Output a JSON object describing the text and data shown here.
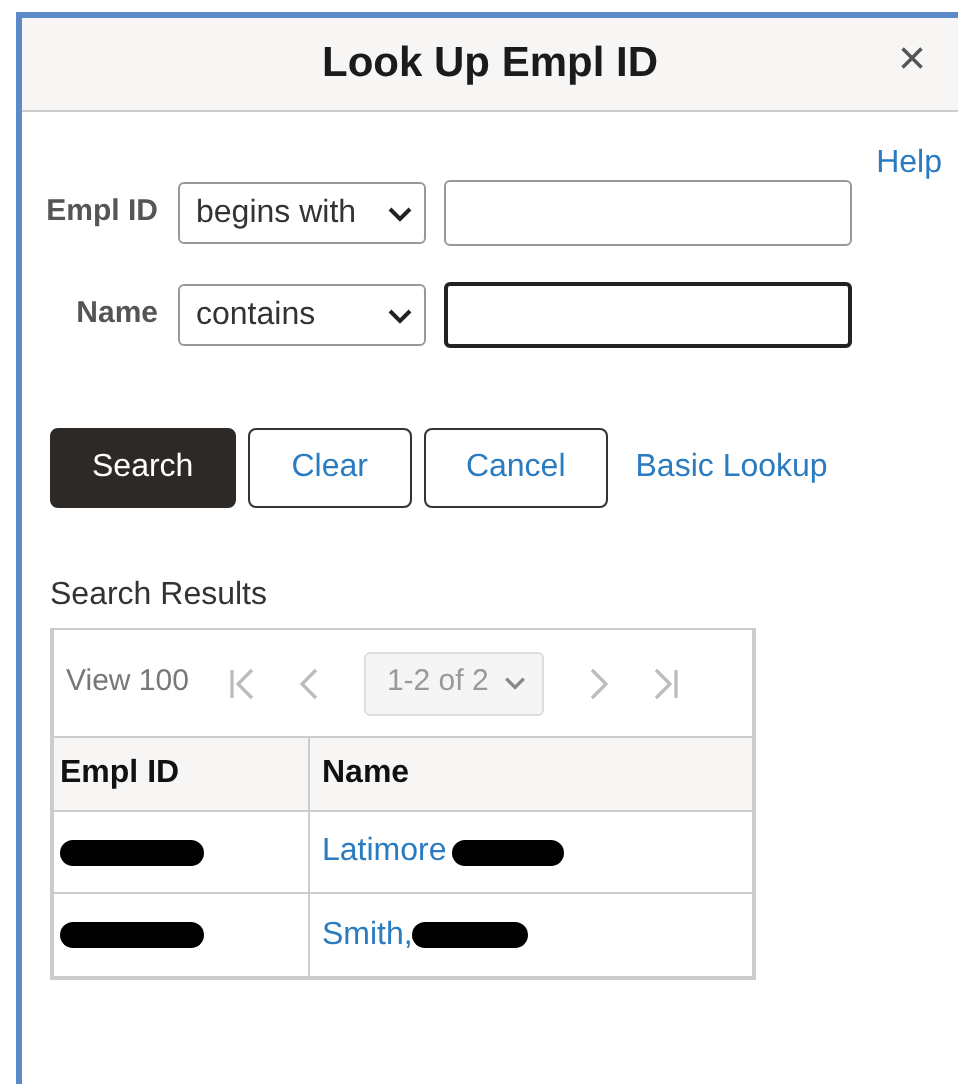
{
  "dialog": {
    "title": "Look Up Empl ID",
    "close": "×",
    "help": "Help"
  },
  "criteria": [
    {
      "label": "Empl ID",
      "operator": "begins with",
      "focused": false
    },
    {
      "label": "Name",
      "operator": "contains",
      "focused": true
    }
  ],
  "buttons": [
    {
      "label": "Search",
      "kind": "primary"
    },
    {
      "label": "Clear",
      "kind": "secondary"
    },
    {
      "label": "Cancel",
      "kind": "secondary"
    },
    {
      "label": "Basic Lookup",
      "kind": "link"
    }
  ],
  "results": {
    "title": "Search Results",
    "view": "View 100",
    "page": "1-2 of 2",
    "pager_disabled": true,
    "columns": [
      "Empl ID",
      "Name"
    ],
    "rows": [
      {
        "empl_id_redacted": true,
        "name": "Latimore",
        "name_redacted": true
      },
      {
        "empl_id_redacted": true,
        "name": "Smith,",
        "name_redacted": true
      }
    ]
  }
}
